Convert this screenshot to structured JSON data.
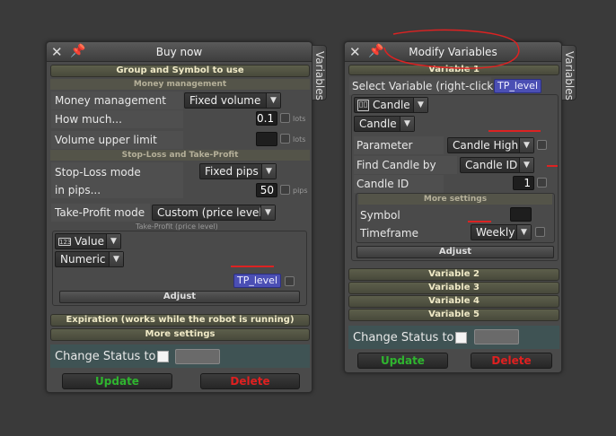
{
  "left": {
    "title": "Buy now",
    "side_tab": "Variables",
    "sec_group": "Group and Symbol to use",
    "sub_money": "Money management",
    "mm_label": "Money management",
    "mm_value": "Fixed volume",
    "how_much_label": "How much...",
    "how_much_value": "0.1",
    "lots": "lots",
    "vul_label": "Volume upper limit",
    "lots2": "lots",
    "sub_sltp": "Stop-Loss and Take-Profit",
    "sl_mode_label": "Stop-Loss mode",
    "sl_mode_value": "Fixed pips",
    "in_pips_label": "in pips...",
    "in_pips_value": "50",
    "pips": "pips",
    "tp_mode_label": "Take-Profit mode",
    "tp_mode_value": "Custom (price level)",
    "tp_caption": "Take-Profit (price level)",
    "value_dd": "Value",
    "numeric_dd": "Numeric",
    "tp_tag": "TP_level",
    "adjust": "Adjust",
    "sec_expiration": "Expiration (works while the robot is running)",
    "sec_more": "More settings",
    "change_status": "Change Status to",
    "update": "Update",
    "delete": "Delete"
  },
  "right": {
    "title": "Modify Variables",
    "side_tab": "Variables",
    "sec_var1": "Variable 1",
    "select_label": "Select Variable (right-click)",
    "select_tag": "TP_level",
    "candle_dd": "Candle",
    "candle_dd2": "Candle",
    "param_label": "Parameter",
    "param_value": "Candle High",
    "find_label": "Find Candle by",
    "find_value": "Candle ID",
    "cid_label": "Candle ID",
    "cid_value": "1",
    "sub_more": "More settings",
    "symbol_label": "Symbol",
    "timeframe_label": "Timeframe",
    "timeframe_value": "Weekly",
    "adjust": "Adjust",
    "var2": "Variable 2",
    "var3": "Variable 3",
    "var4": "Variable 4",
    "var5": "Variable 5",
    "change_status": "Change Status to",
    "update": "Update",
    "delete": "Delete"
  },
  "colors": {
    "update": "#2fb52f",
    "delete": "#e02020",
    "annotation": "#dd2222",
    "tag": "#4b4fb4"
  }
}
